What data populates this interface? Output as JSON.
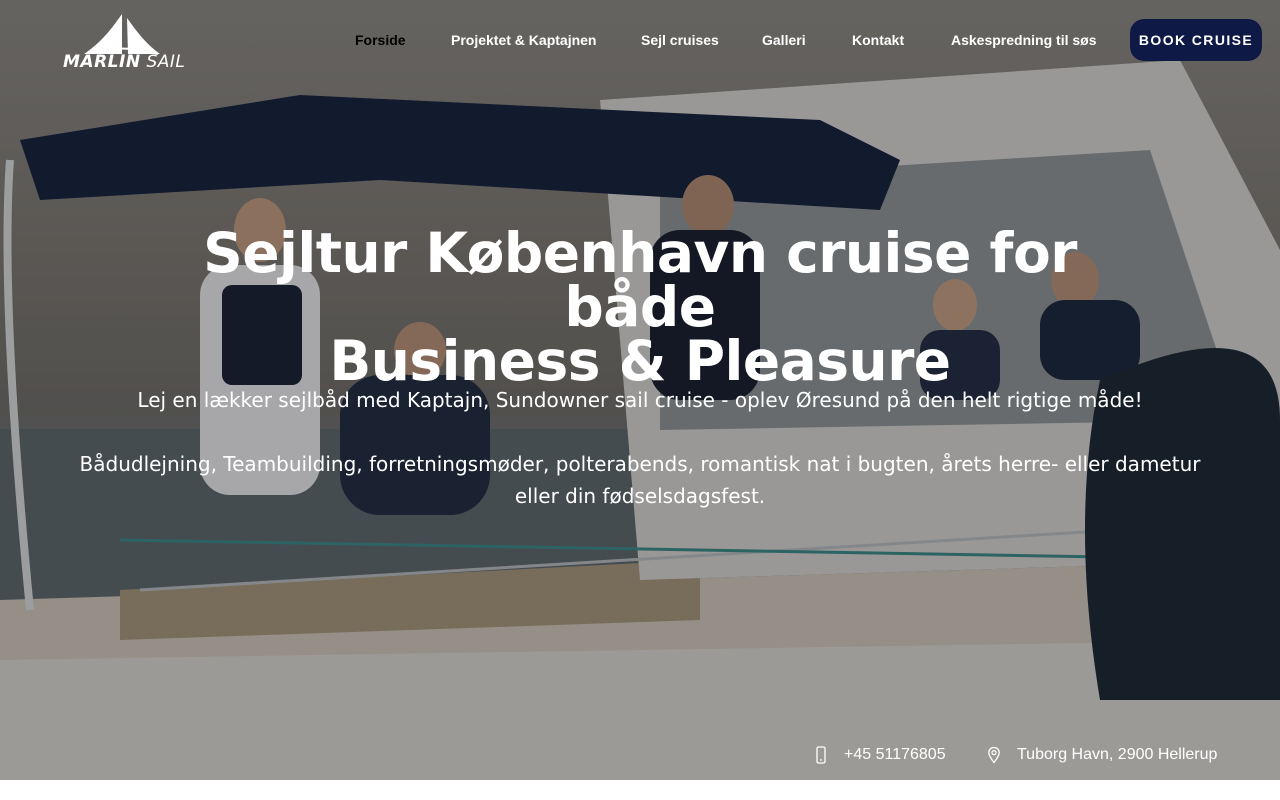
{
  "header": {
    "logo_bold": "MARLIN",
    "logo_light": "SAIL",
    "nav": [
      {
        "label": "Forside",
        "active": true
      },
      {
        "label": "Projektet & Kaptajnen",
        "active": false
      },
      {
        "label": "Sejl cruises",
        "active": false
      },
      {
        "label": "Galleri",
        "active": false
      },
      {
        "label": "Kontakt",
        "active": false
      },
      {
        "label": "Askespredning til søs",
        "active": false
      }
    ],
    "cta": "BOOK CRUISE"
  },
  "hero": {
    "headline_line1": "Sejltur København cruise for både",
    "headline_line2": "Business & Pleasure",
    "sub1": "Lej en lækker sejlbåd med Kaptajn, Sundowner sail cruise - oplev Øresund på den helt rigtige måde!",
    "sub2": "Bådudlejning, Teambuilding, forretningsmøder, polterabends, romantisk nat i bugten, årets herre- eller dametur eller din fødselsdagsfest."
  },
  "contact": {
    "phone": "+45 51176805",
    "address": "Tuborg Havn, 2900 Hellerup",
    "phone_icon": "mobile-phone-icon",
    "address_icon": "map-pin-icon"
  },
  "colors": {
    "cta_bg": "#0e1a45",
    "text": "#ffffff",
    "active_nav": "#000000"
  }
}
